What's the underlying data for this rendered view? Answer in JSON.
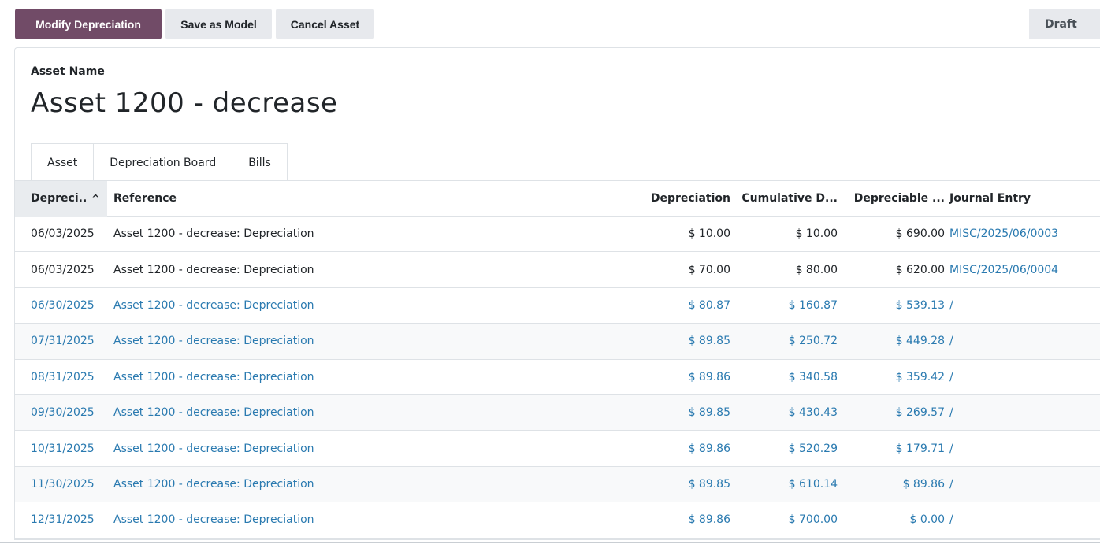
{
  "toolbar": {
    "modify_label": "Modify Depreciation",
    "save_model_label": "Save as Model",
    "cancel_label": "Cancel Asset",
    "status_label": "Draft"
  },
  "form": {
    "field_label": "Asset Name",
    "asset_name": "Asset 1200 - decrease"
  },
  "tabs": [
    {
      "label": "Asset",
      "active": false
    },
    {
      "label": "Depreciation Board",
      "active": true
    },
    {
      "label": "Bills",
      "active": false
    }
  ],
  "table": {
    "headers": {
      "date": "Depreci..",
      "reference": "Reference",
      "depreciation": "Depreciation",
      "cumulative": "Cumulative D...",
      "depreciable": "Depreciable ...",
      "journal": "Journal Entry"
    },
    "rows": [
      {
        "date": "06/03/2025",
        "reference": "Asset 1200 - decrease: Depreciation",
        "depreciation": "$ 10.00",
        "cumulative": "$ 10.00",
        "depreciable": "$ 690.00",
        "journal": "MISC/2025/06/0003"
      },
      {
        "date": "06/03/2025",
        "reference": "Asset 1200 - decrease: Depreciation",
        "depreciation": "$ 70.00",
        "cumulative": "$ 80.00",
        "depreciable": "$ 620.00",
        "journal": "MISC/2025/06/0004"
      },
      {
        "date": "06/30/2025",
        "reference": "Asset 1200 - decrease: Depreciation",
        "depreciation": "$ 80.87",
        "cumulative": "$ 160.87",
        "depreciable": "$ 539.13",
        "journal": "/"
      },
      {
        "date": "07/31/2025",
        "reference": "Asset 1200 - decrease: Depreciation",
        "depreciation": "$ 89.85",
        "cumulative": "$ 250.72",
        "depreciable": "$ 449.28",
        "journal": "/"
      },
      {
        "date": "08/31/2025",
        "reference": "Asset 1200 - decrease: Depreciation",
        "depreciation": "$ 89.86",
        "cumulative": "$ 340.58",
        "depreciable": "$ 359.42",
        "journal": "/"
      },
      {
        "date": "09/30/2025",
        "reference": "Asset 1200 - decrease: Depreciation",
        "depreciation": "$ 89.85",
        "cumulative": "$ 430.43",
        "depreciable": "$ 269.57",
        "journal": "/"
      },
      {
        "date": "10/31/2025",
        "reference": "Asset 1200 - decrease: Depreciation",
        "depreciation": "$ 89.86",
        "cumulative": "$ 520.29",
        "depreciable": "$ 179.71",
        "journal": "/"
      },
      {
        "date": "11/30/2025",
        "reference": "Asset 1200 - decrease: Depreciation",
        "depreciation": "$ 89.85",
        "cumulative": "$ 610.14",
        "depreciable": "$ 89.86",
        "journal": "/"
      },
      {
        "date": "12/31/2025",
        "reference": "Asset 1200 - decrease: Depreciation",
        "depreciation": "$ 89.86",
        "cumulative": "$ 700.00",
        "depreciable": "$ 0.00",
        "journal": "/"
      }
    ]
  },
  "colors": {
    "primary": "#714b67",
    "draft_text": "#2a7ab0",
    "link": "#017e84"
  }
}
